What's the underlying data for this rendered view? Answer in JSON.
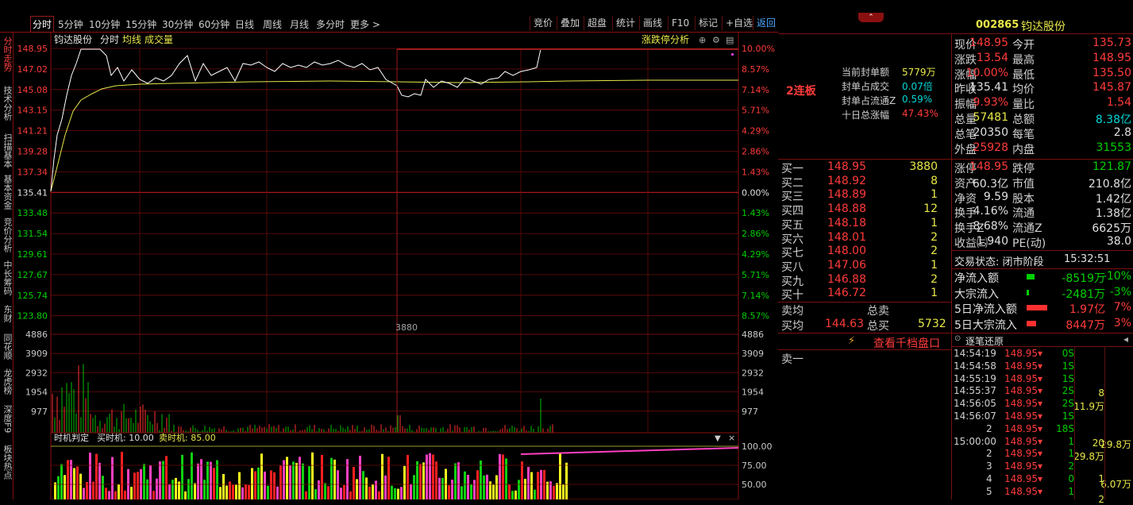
{
  "stock": {
    "code": "002865",
    "name": "钧达股份"
  },
  "periods": [
    "分时",
    "5分钟",
    "10分钟",
    "15分钟",
    "30分钟",
    "60分钟",
    "日线",
    "周线",
    "月线",
    "多分时",
    "更多 >"
  ],
  "tools": [
    "竞价",
    "叠加",
    "超盘",
    "统计",
    "画线",
    "F10",
    "标记",
    "+自选",
    "返回"
  ],
  "left_tabs": [
    "分时走势",
    "技术分析",
    "扫描基本",
    "基本资金",
    "竞价分析",
    "中长筹码",
    "东财",
    "同花顺",
    "龙虎榜",
    "深度F9",
    "板块热点"
  ],
  "chart": {
    "legend": {
      "name": "钧达股份",
      "mode": "分时",
      "avg": "均线",
      "vol": "成交量"
    },
    "limit_analysis": "涨跌停分析",
    "price_ticks": [
      "148.95",
      "147.02",
      "145.08",
      "143.15",
      "141.21",
      "139.28",
      "137.34",
      "135.41",
      "133.48",
      "131.54",
      "129.61",
      "127.67",
      "125.74",
      "123.80"
    ],
    "pct_ticks": [
      "10.00%",
      "8.57%",
      "7.14%",
      "5.71%",
      "4.29%",
      "2.86%",
      "1.43%",
      "0.00%",
      "1.43%",
      "2.86%",
      "4.29%",
      "5.71%",
      "7.14%",
      "8.57%"
    ],
    "vol_ticks": [
      "4886",
      "3909",
      "2932",
      "1954",
      "977"
    ],
    "vol_cursor": "3880",
    "prev_close": 135.41,
    "price_max": 148.95,
    "price_min": 123.8
  },
  "indicator": {
    "title": "时机判定",
    "buy": "买时机: 10.00",
    "sell": "卖时机: 85.00",
    "ticks": [
      "100.00",
      "75.00",
      "50.00"
    ]
  },
  "limit_info": {
    "streak": "2连板",
    "rows": [
      {
        "label": "当前封单额",
        "value": "5779万"
      },
      {
        "label": "封单占成交",
        "value": "0.07倍"
      },
      {
        "label": "封单占流通Z",
        "value": "0.59%"
      },
      {
        "label": "十日总涨幅",
        "value": "47.43%"
      }
    ]
  },
  "quote": {
    "rows": [
      [
        "现价",
        "148.95",
        "今开",
        "135.73"
      ],
      [
        "涨跌",
        "13.54",
        "最高",
        "148.95"
      ],
      [
        "涨幅",
        "10.00%",
        "最低",
        "135.50"
      ],
      [
        "昨收",
        "135.41",
        "均价",
        "145.87"
      ],
      [
        "振幅",
        "9.93%",
        "量比",
        "1.54"
      ],
      [
        "总量",
        "57481",
        "总额",
        "8.38亿"
      ],
      [
        "总笔",
        "20350",
        "每笔",
        "2.8"
      ],
      [
        "外盘",
        "25928",
        "内盘",
        "31553"
      ]
    ],
    "rows2": [
      [
        "涨停",
        "148.95",
        "跌停",
        "121.87"
      ],
      [
        "资产",
        "60.3亿",
        "市值",
        "210.8亿"
      ],
      [
        "净资",
        "9.59",
        "股本",
        "1.42亿"
      ],
      [
        "换手",
        "4.16%",
        "流通",
        "1.38亿"
      ],
      [
        "换手Z",
        "8.68%",
        "流通Z",
        "6625万"
      ],
      [
        "收益㈢",
        "1.940",
        "PE(动)",
        "38.0"
      ]
    ],
    "status": "交易状态: 闭市阶段",
    "time": "15:32:51",
    "flows": [
      {
        "label": "净流入额",
        "value": "-8519万",
        "pct": "-10%",
        "color": "#00d000",
        "w": 10
      },
      {
        "label": "大宗流入",
        "value": "-2481万",
        "pct": "-3%",
        "color": "#00d000",
        "w": 3
      },
      {
        "label": "5日净流入额",
        "value": "1.97亿",
        "pct": "7%",
        "color": "#ff3030",
        "w": 26
      },
      {
        "label": "5日大宗流入",
        "value": "8447万",
        "pct": "3%",
        "color": "#ff3030",
        "w": 12
      }
    ]
  },
  "orderbook": {
    "bids": [
      {
        "label": "买一",
        "price": "148.95",
        "vol": "3880"
      },
      {
        "label": "买二",
        "price": "148.92",
        "vol": "8"
      },
      {
        "label": "买三",
        "price": "148.89",
        "vol": "1"
      },
      {
        "label": "买四",
        "price": "148.88",
        "vol": "12"
      },
      {
        "label": "买五",
        "price": "148.18",
        "vol": "1"
      },
      {
        "label": "买六",
        "price": "148.01",
        "vol": "2"
      },
      {
        "label": "买七",
        "price": "148.00",
        "vol": "2"
      },
      {
        "label": "买八",
        "price": "147.06",
        "vol": "1"
      },
      {
        "label": "买九",
        "price": "146.88",
        "vol": "2"
      },
      {
        "label": "买十",
        "price": "146.72",
        "vol": "1"
      }
    ],
    "ask_avg_label": "卖均",
    "total_sell_label": "总卖",
    "bid_avg_label": "买均",
    "bid_avg": "144.63",
    "total_buy_label": "总买",
    "total_buy": "5732",
    "thousand_link": "查看千档盘口",
    "ask1": "卖一"
  },
  "ticks": {
    "title": "逐笔还原",
    "rows": [
      {
        "time": "14:54:19",
        "price": "148.95",
        "vol": "0S"
      },
      {
        "time": "14:54:58",
        "price": "148.95",
        "vol": "1S"
      },
      {
        "time": "14:55:19",
        "price": "148.95",
        "vol": "1S"
      },
      {
        "time": "14:55:37",
        "price": "148.95",
        "vol": "2S"
      },
      {
        "time": "14:56:05",
        "price": "148.95",
        "vol": "2S"
      },
      {
        "time": "14:56:07",
        "price": "148.95",
        "vol": "1S"
      },
      {
        "time": "2",
        "price": "148.95",
        "vol": "18S"
      },
      {
        "time": "15:00:00",
        "price": "148.95",
        "vol": "1"
      },
      {
        "time": "2",
        "price": "148.95",
        "vol": "1"
      },
      {
        "time": "3",
        "price": "148.95",
        "vol": "2"
      },
      {
        "time": "4",
        "price": "148.95",
        "vol": "0"
      },
      {
        "time": "5",
        "price": "148.95",
        "vol": "1"
      }
    ],
    "side": [
      {
        "a": "8",
        "b": ""
      },
      {
        "a": "11.9万",
        "b": ""
      },
      {
        "a": "20",
        "b": "29.8万"
      },
      {
        "a": "29.8万",
        "b": ""
      },
      {
        "a": "1",
        "b": ""
      },
      {
        "a": "",
        "b": "6.07万"
      },
      {
        "a": "2",
        "b": ""
      }
    ]
  }
}
